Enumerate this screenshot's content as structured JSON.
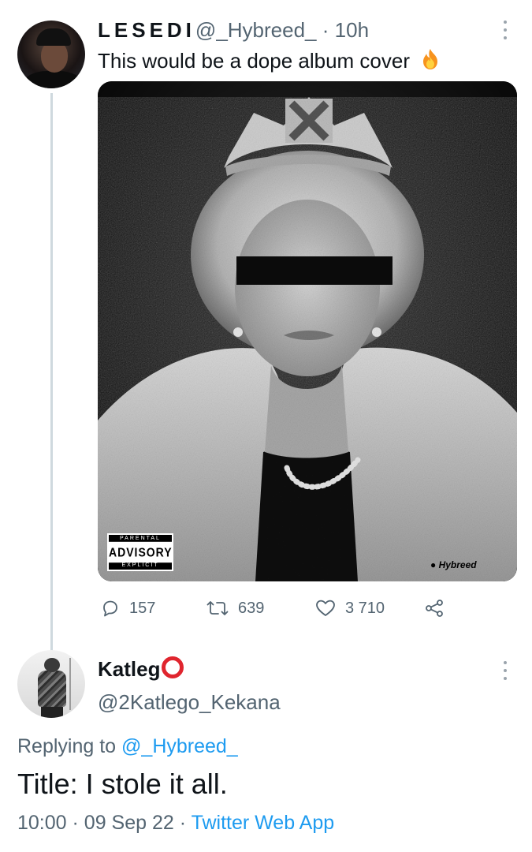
{
  "tweet": {
    "display_name": "LESEDI",
    "handle": "@_Hybreed_",
    "separator": "·",
    "time": "10h",
    "text": "This would be a dope album cover",
    "emoji_icon": "fire-icon",
    "media": {
      "advisory": {
        "top": "PARENTAL",
        "middle": "ADVISORY",
        "bottom": "EXPLICIT CONTENT"
      },
      "watermark": "Hybreed"
    },
    "actions": {
      "replies": "157",
      "retweets": "639",
      "likes": "3 710"
    }
  },
  "reply": {
    "display_name": "Katleg",
    "name_emoji_icon": "red-circle-icon",
    "handle": "@2Katlego_Kekana",
    "replying_prefix": "Replying to",
    "replying_handle": "@_Hybreed_",
    "text": "Title: I stole it all.",
    "time": "10:00",
    "separator": "·",
    "date": "09 Sep 22",
    "separator2": "·",
    "source": "Twitter Web App"
  },
  "colors": {
    "secondary_text": "#536471",
    "link": "#1d9bf0",
    "thread_line": "#cfd9de",
    "red_circle": "#e0252e"
  }
}
